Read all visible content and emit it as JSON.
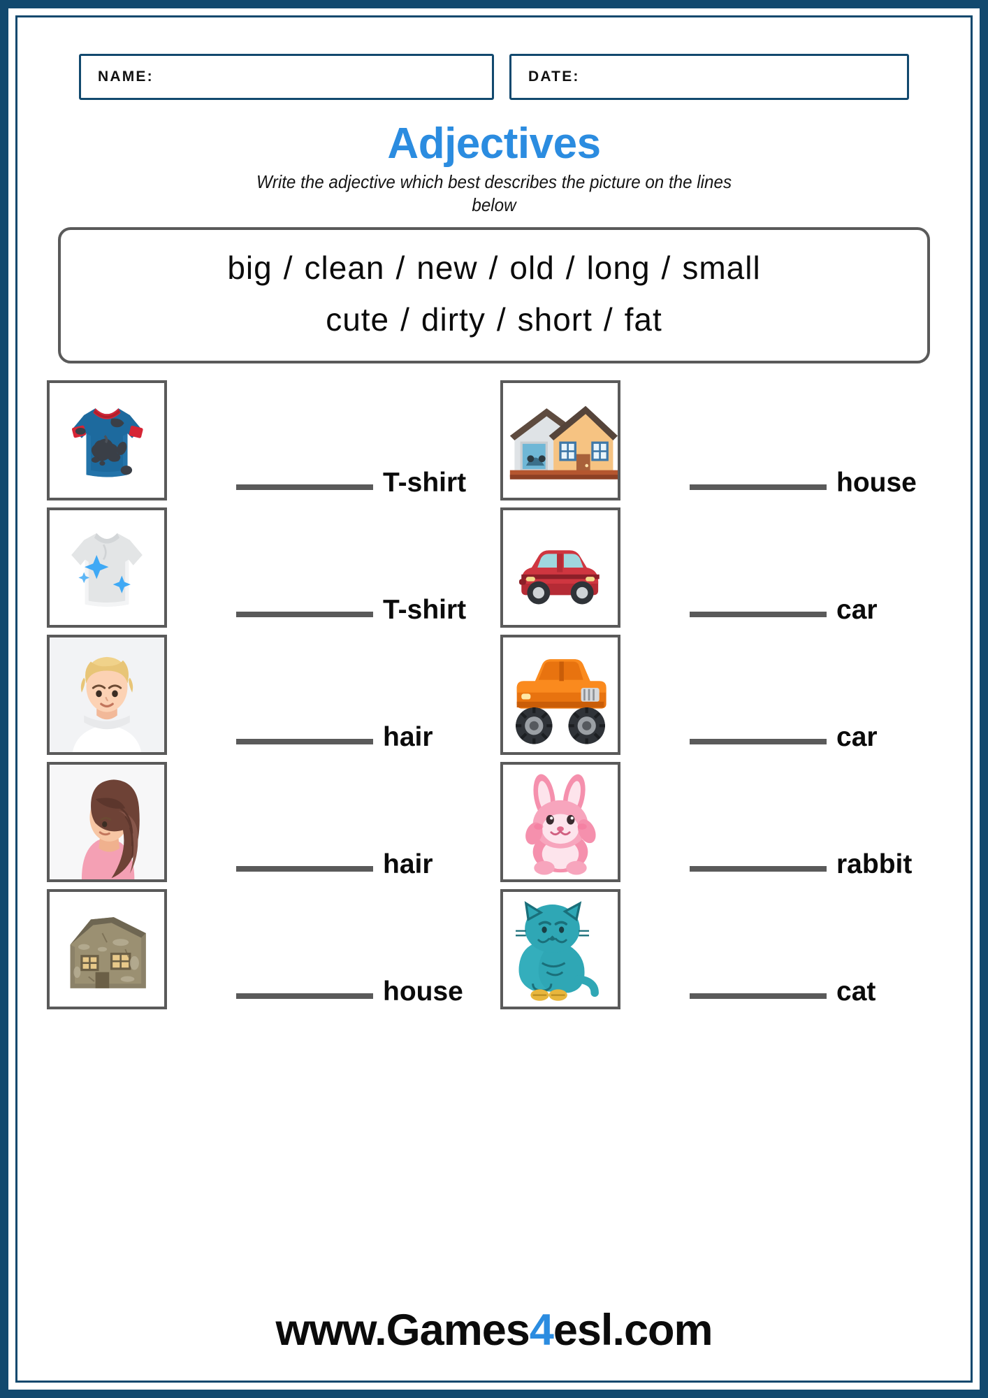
{
  "page": {
    "border_color": "#12496e",
    "accent_color": "#2b8ce0",
    "frame_color": "#5a5a5a"
  },
  "header": {
    "name_label": "NAME:",
    "date_label": "DATE:",
    "name_value": "",
    "date_value": ""
  },
  "title": "Adjectives",
  "instructions": "Write the adjective which best describes the picture on the lines below",
  "word_bank": {
    "line1": [
      "big",
      "clean",
      "new",
      "old",
      "long",
      "small"
    ],
    "line2": [
      "cute",
      "dirty",
      "short",
      "fat"
    ],
    "separator": "/"
  },
  "questions": [
    {
      "n": 1,
      "column": "left",
      "icon": "dirty-tshirt-icon",
      "label": "T-shirt",
      "answer": ""
    },
    {
      "n": 2,
      "column": "right",
      "icon": "new-house-icon",
      "label": "house",
      "answer": ""
    },
    {
      "n": 3,
      "column": "left",
      "icon": "clean-tshirt-icon",
      "label": "T-shirt",
      "answer": ""
    },
    {
      "n": 4,
      "column": "right",
      "icon": "small-car-icon",
      "label": "car",
      "answer": ""
    },
    {
      "n": 5,
      "column": "left",
      "icon": "short-hair-girl-icon",
      "label": "hair",
      "answer": ""
    },
    {
      "n": 6,
      "column": "right",
      "icon": "big-monster-truck-icon",
      "label": "car",
      "answer": ""
    },
    {
      "n": 7,
      "column": "left",
      "icon": "long-hair-girl-icon",
      "label": "hair",
      "answer": ""
    },
    {
      "n": 8,
      "column": "right",
      "icon": "cute-rabbit-icon",
      "label": "rabbit",
      "answer": ""
    },
    {
      "n": 9,
      "column": "left",
      "icon": "old-house-icon",
      "label": "house",
      "answer": ""
    },
    {
      "n": 10,
      "column": "right",
      "icon": "fat-cat-icon",
      "label": "cat",
      "answer": ""
    }
  ],
  "footer": {
    "prefix": "www.Games",
    "accent": "4",
    "suffix": "esl.com"
  }
}
